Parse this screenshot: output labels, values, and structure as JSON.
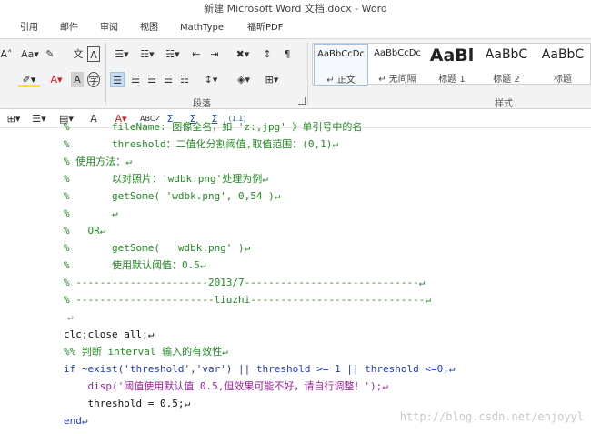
{
  "window": {
    "title": "新建 Microsoft Word 文档.docx - Word"
  },
  "tabs": [
    "引用",
    "邮件",
    "审阅",
    "视图",
    "MathType",
    "福昕PDF"
  ],
  "ribbon": {
    "group_paragraph_label": "段落",
    "group_styles_label": "样式",
    "styles": [
      {
        "sample": "AaBbCcDc",
        "name": "↵ 正文"
      },
      {
        "sample": "AaBbCcDc",
        "name": "↵ 无间隔"
      },
      {
        "sample": "AaBl",
        "name": "标题 1"
      },
      {
        "sample": "AaBbC",
        "name": "标题 2"
      },
      {
        "sample": "AaBbC",
        "name": "标题"
      }
    ]
  },
  "qat": {
    "zoom_label": "(1.1)"
  },
  "document": {
    "line_partial": "%       fileName: 图像全名，如 'z:,jpg' 》单引号中的名",
    "threshold_label": "%       threshold：二值化分割阈值,取值范围：(0,1)↵",
    "usage_label": "% 使用方法：↵",
    "example_text": "%       以对照片：'wdbk.png'处理为例↵",
    "example_call": "%       getSome( 'wdbk.png', 0,54 )↵",
    "blank_comment": "%       ↵",
    "or_label": "%   OR↵",
    "or_call": "%       getSome(  'wdbk.png' )↵",
    "default_text": "%       使用默认阈值：0.5↵",
    "sep_date": "% ----------------------2013/7-----------------------------↵",
    "sep_author": "% -----------------------liuzhi-----------------------------↵",
    "empty_line": "↵",
    "clc_line": "clc;close all;↵",
    "check_comment": "%% 判断 interval 输入的有效性↵",
    "if_line": "if ~exist('threshold','var') || threshold >= 1 || threshold <=0;↵",
    "disp_line": "    disp('阈值使用默认值 0.5,但效果可能不好，请自行调整！');↵",
    "assign_line": "    threshold = 0.5;↵",
    "end_line": "end↵"
  },
  "watermark": "http://blog.csdn.net/enjoyyl"
}
